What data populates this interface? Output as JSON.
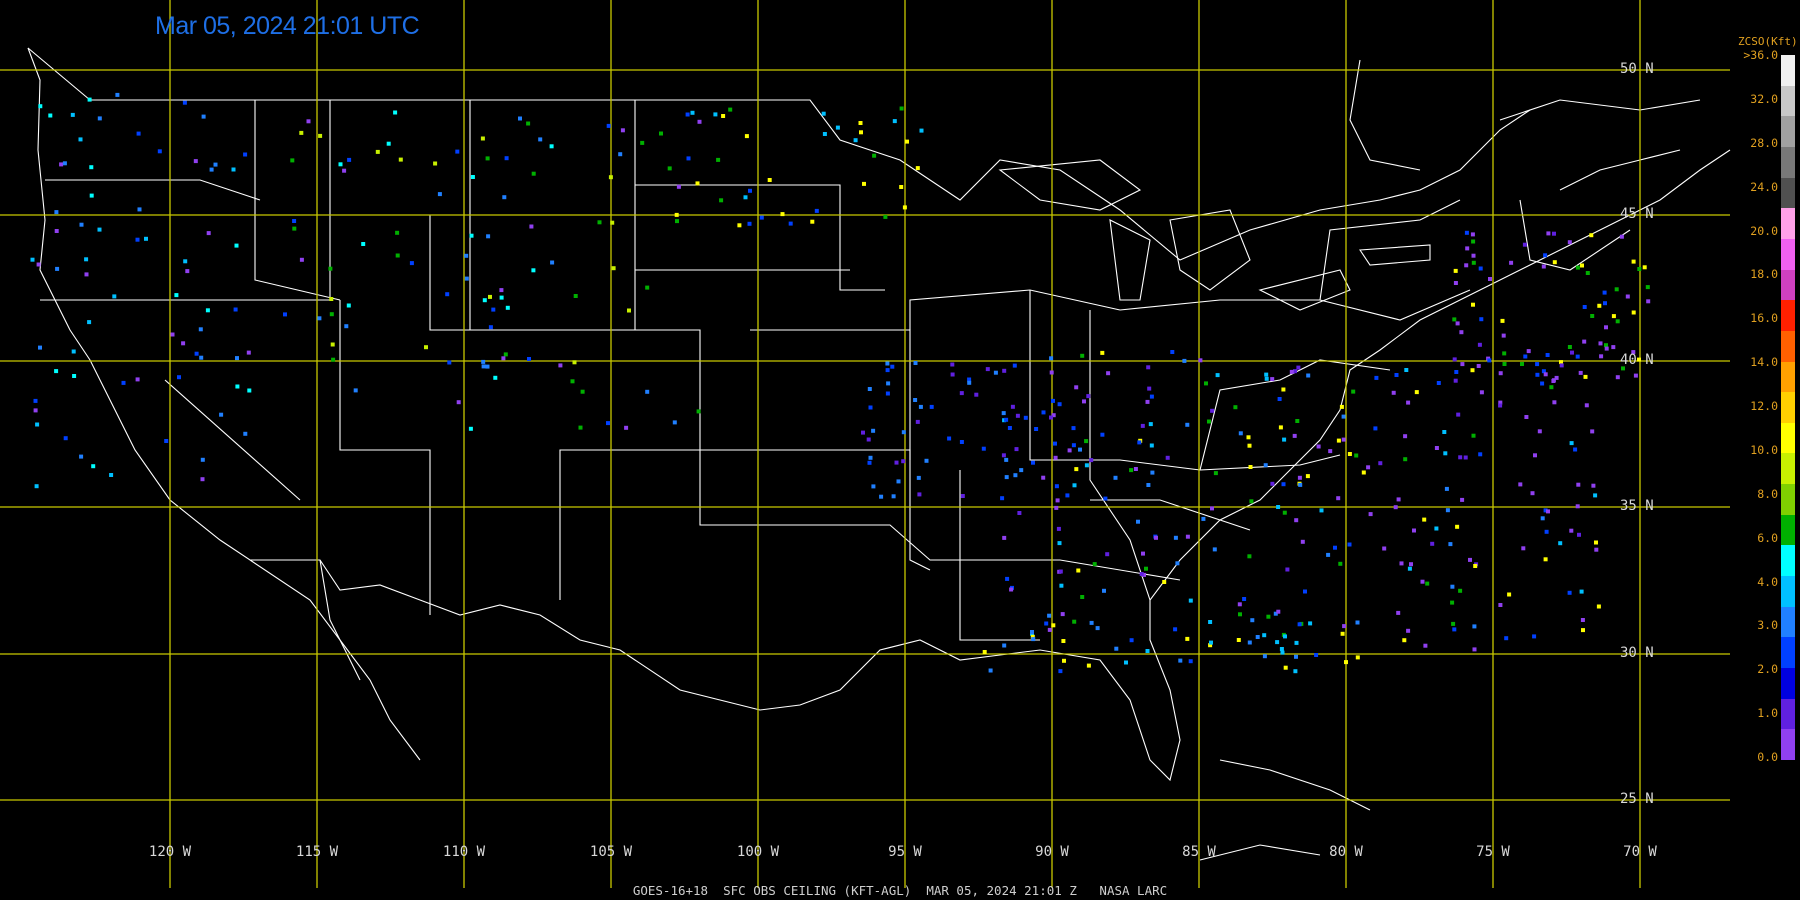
{
  "title": "Mar 05, 2024 21:01 UTC",
  "footer": "GOES-16+18  SFC OBS CEILING (KFT-AGL)  MAR 05, 2024 21:01 Z   NASA LARC",
  "lat_labels": [
    "50 N",
    "45 N",
    "40 N",
    "35 N",
    "30 N",
    "25 N"
  ],
  "lon_labels": [
    "120 W",
    "115 W",
    "110 W",
    "105 W",
    "100 W",
    "95 W",
    "90 W",
    "85 W",
    "80 W",
    "75 W",
    "70 W"
  ],
  "colorbar": {
    "title": "ZCSO(Kft)",
    "labels": [
      ">36.0",
      "32.0",
      "28.0",
      "24.0",
      "20.0",
      "18.0",
      "16.0",
      "14.0",
      "12.0",
      "10.0",
      "8.0",
      "6.0",
      "4.0",
      "3.0",
      "2.0",
      "1.0",
      "0.0"
    ],
    "colors": [
      "#f0f0f0",
      "#c8c8c8",
      "#a0a0a0",
      "#787878",
      "#505050",
      "#ffa0e8",
      "#f060f0",
      "#d040c0",
      "#ff2000",
      "#ff6000",
      "#ffa000",
      "#ffd000",
      "#ffff00",
      "#c8f000",
      "#80d000",
      "#00b000",
      "#00ffff",
      "#00c0ff",
      "#2080ff",
      "#0040ff",
      "#0000e0",
      "#6020e0",
      "#9040f0"
    ]
  },
  "colors": {
    "grid": "#c8c800",
    "boundary": "#ffffff",
    "title": "#1e6fe6",
    "colorbar_text": "#e0a020"
  }
}
